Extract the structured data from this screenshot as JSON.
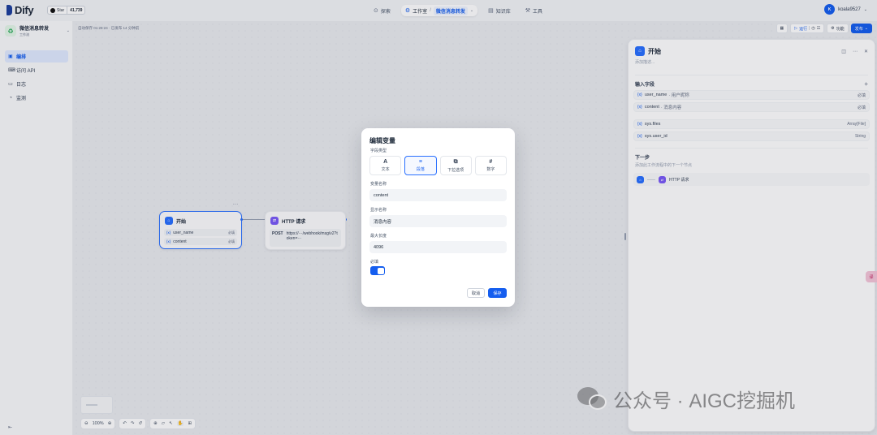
{
  "brand": {
    "name": "Dify",
    "star_label": "Star",
    "star_count": "41,739"
  },
  "nav": {
    "explore": "探索",
    "studio": "工作室",
    "current_app": "微信消息转发",
    "knowledge": "知识库",
    "tools": "工具"
  },
  "user": {
    "initial": "K",
    "name": "koala9527"
  },
  "app": {
    "name": "微信消息转发",
    "type": "工作流"
  },
  "sidebar": {
    "items": [
      {
        "label": "编排"
      },
      {
        "label": "访问 API"
      },
      {
        "label": "日志"
      },
      {
        "label": "监测"
      }
    ]
  },
  "canvas": {
    "autosave": "自动保存 01:28:24 · 已发布 14 分钟前",
    "run": "运行",
    "features": "功能",
    "publish": "发布"
  },
  "nodes": {
    "start": {
      "title": "开始",
      "more": "...",
      "vars": [
        {
          "name": "user_name",
          "required": "必填"
        },
        {
          "name": "content",
          "required": "必填"
        }
      ]
    },
    "http": {
      "title": "HTTP 请求",
      "method": "POST",
      "url": "https://···/webhook/msg/v2?token=···"
    }
  },
  "bottom_tools": {
    "zoom": "100%"
  },
  "right_panel": {
    "title": "开始",
    "description": "添加描述...",
    "input_fields_title": "输入字段",
    "fields": [
      {
        "name": "user_name",
        "label": "· 用户昵称",
        "meta": "必填"
      },
      {
        "name": "content",
        "label": "· 消息内容",
        "meta": "必填"
      }
    ],
    "sys_fields": [
      {
        "name": "sys.files",
        "meta": "Array[File]"
      },
      {
        "name": "sys.user_id",
        "meta": "String"
      }
    ],
    "next_title": "下一步",
    "next_desc": "添加此工作流程中的下一个节点",
    "next_node": "HTTP 请求"
  },
  "modal": {
    "title": "编辑变量",
    "field_type_label": "字段类型",
    "types": [
      {
        "icon": "A",
        "label": "文本"
      },
      {
        "icon": "≡",
        "label": "段落"
      },
      {
        "icon": "⧉",
        "label": "下拉选项"
      },
      {
        "icon": "#",
        "label": "数字"
      }
    ],
    "selected_type": "段落",
    "var_name_label": "变量名称",
    "var_name_value": "content",
    "display_name_label": "显示名称",
    "display_name_value": "消息内容",
    "max_length_label": "最大长度",
    "max_length_value": "4096",
    "required_label": "必填",
    "required_on": true,
    "cancel": "取消",
    "save": "保存"
  },
  "watermark": {
    "text": "公众号 · AIGC挖掘机"
  },
  "side_tab": {
    "label": "译"
  },
  "colors": {
    "primary": "#155eef",
    "start_node": "#2970ff",
    "http_node": "#7a5af8"
  }
}
